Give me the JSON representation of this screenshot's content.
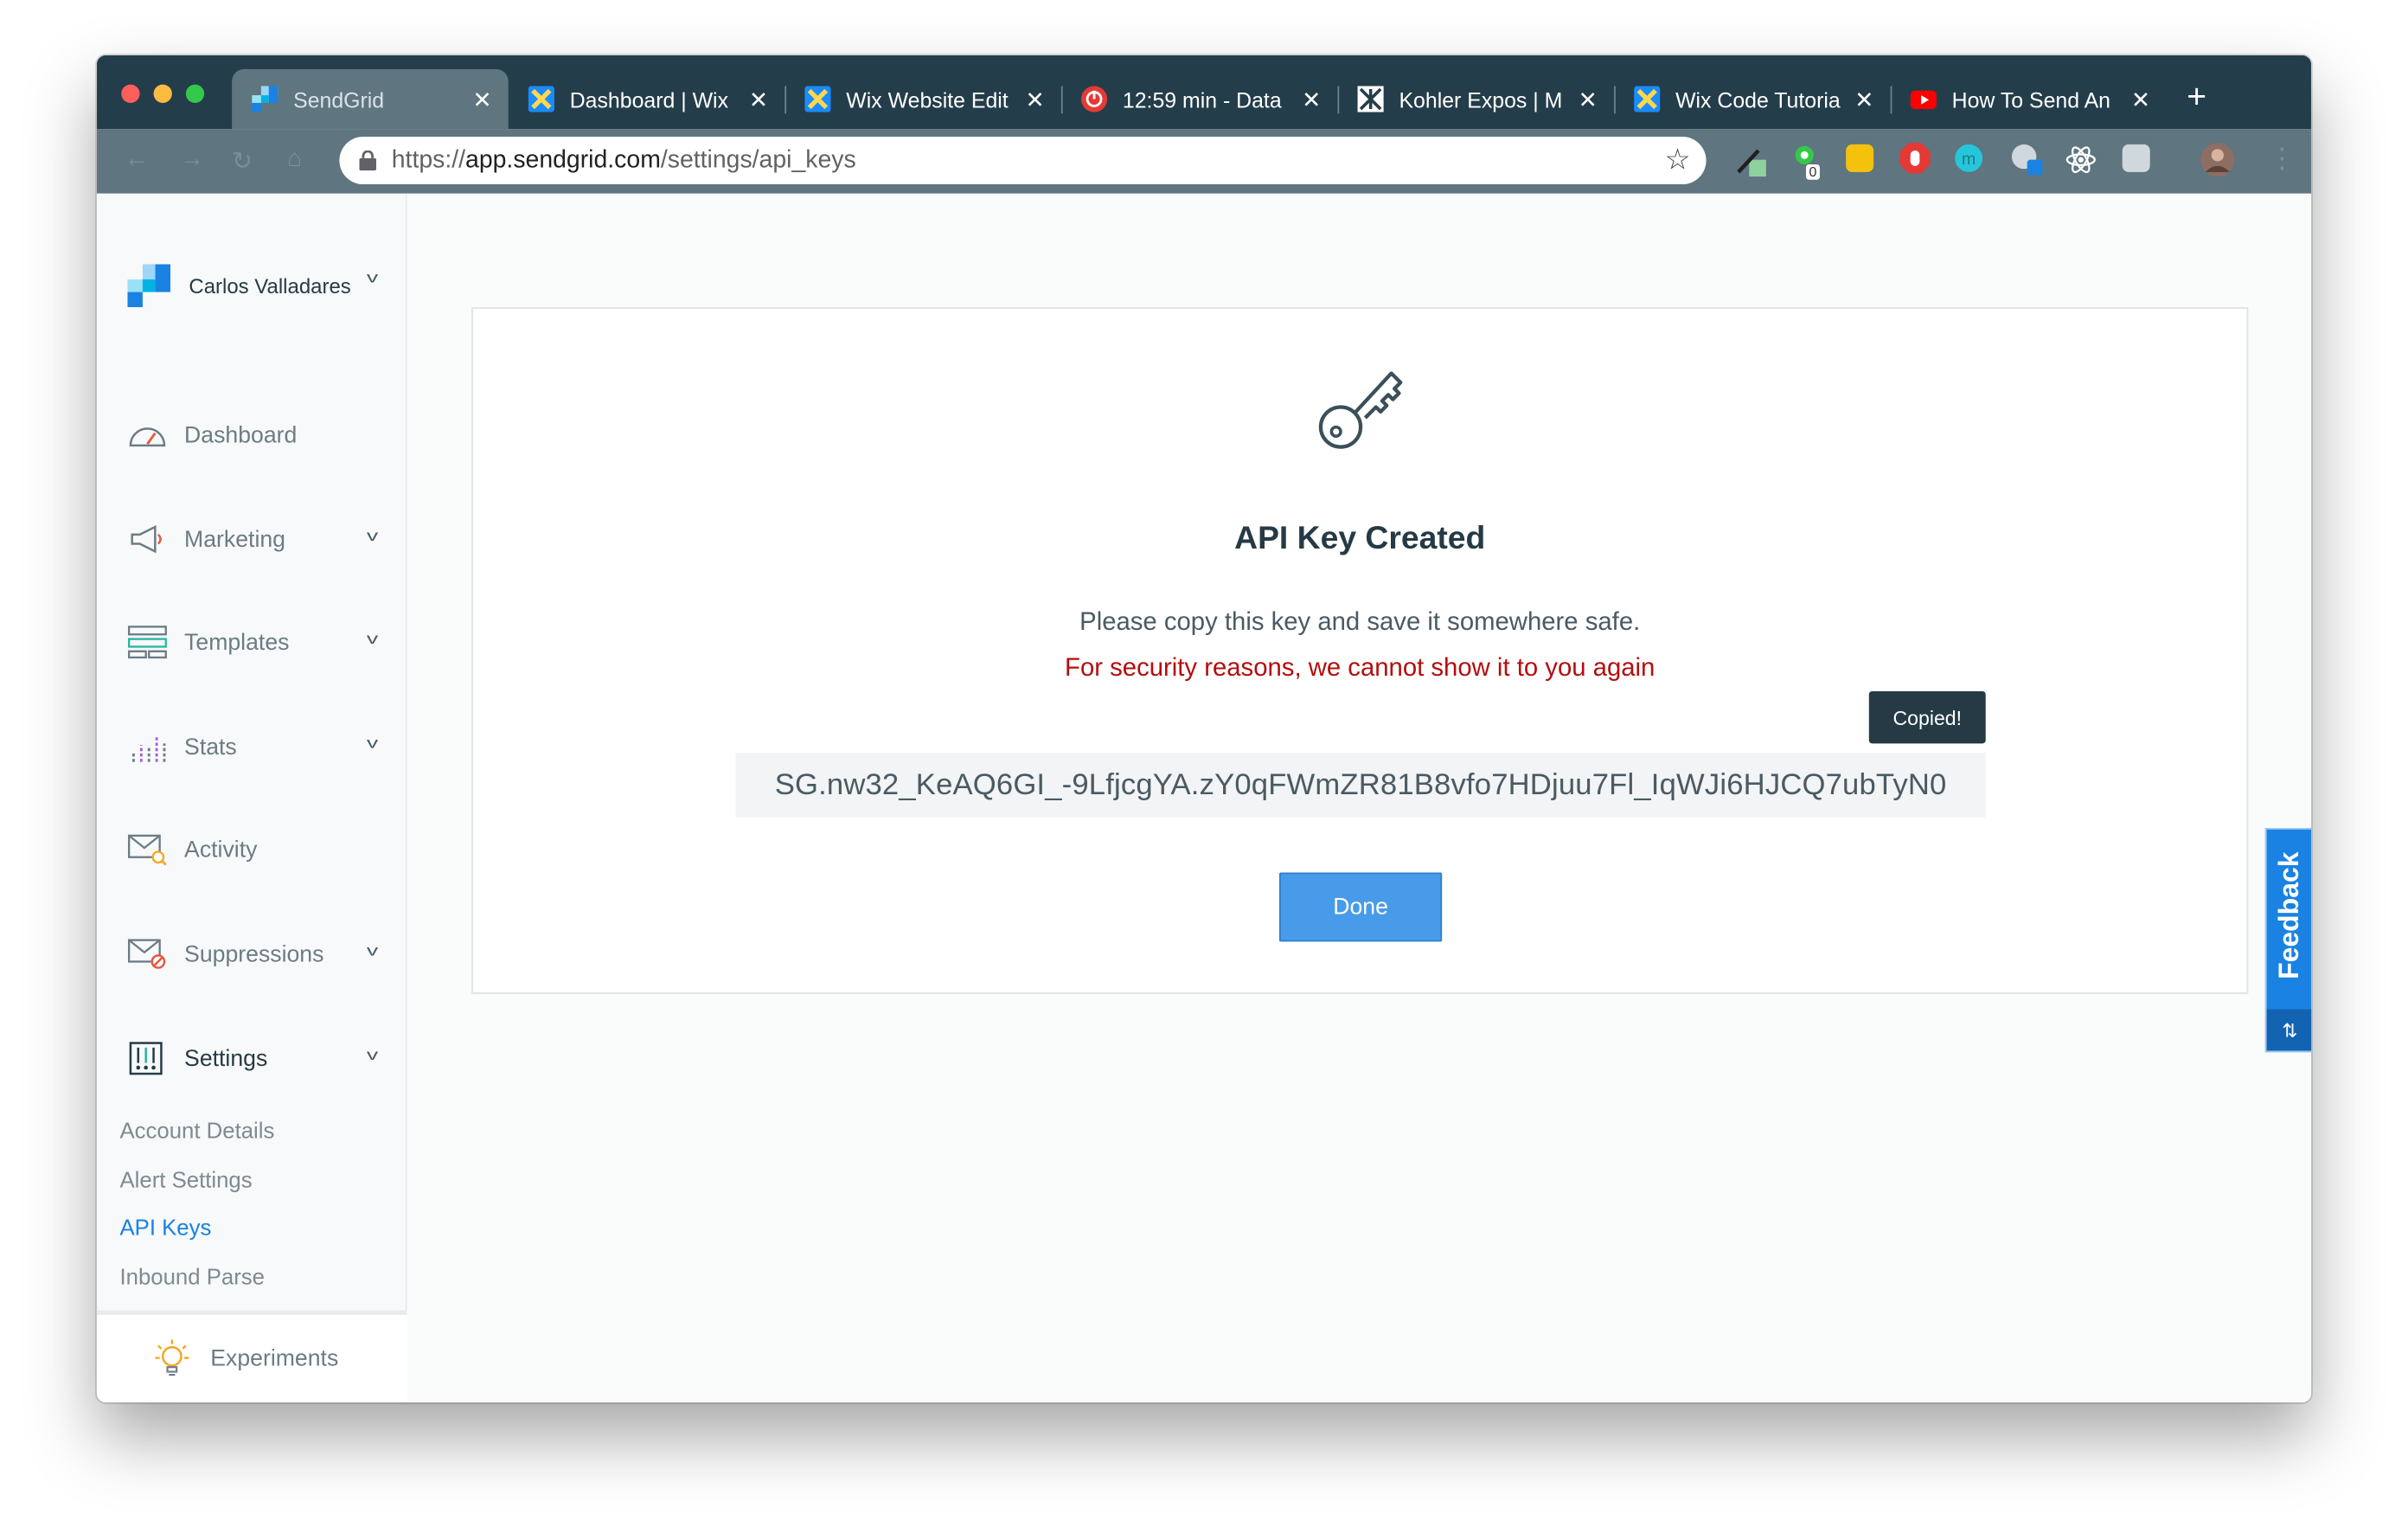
{
  "browser": {
    "tabs": [
      {
        "title": "SendGrid",
        "active": true
      },
      {
        "title": "Dashboard | Wix",
        "active": false
      },
      {
        "title": "Wix Website Edit",
        "active": false
      },
      {
        "title": "12:59 min - Data",
        "active": false
      },
      {
        "title": "Kohler Expos | M",
        "active": false
      },
      {
        "title": "Wix Code Tutoria",
        "active": false
      },
      {
        "title": "How To Send An",
        "active": false
      }
    ],
    "new_tab": "+",
    "close_glyph": "✕",
    "url_scheme": "https://",
    "url_host": "app.sendgrid.com",
    "url_path": "/settings/api_keys",
    "star_glyph": "☆",
    "extension_badge": "0"
  },
  "sidebar": {
    "account_name": "Carlos Valladares",
    "nav": [
      {
        "label": "Dashboard",
        "icon": "dashboard-icon",
        "has_chevron": false
      },
      {
        "label": "Marketing",
        "icon": "megaphone-icon",
        "has_chevron": true
      },
      {
        "label": "Templates",
        "icon": "templates-icon",
        "has_chevron": true
      },
      {
        "label": "Stats",
        "icon": "stats-icon",
        "has_chevron": true
      },
      {
        "label": "Activity",
        "icon": "activity-icon",
        "has_chevron": false
      },
      {
        "label": "Suppressions",
        "icon": "suppressions-icon",
        "has_chevron": true
      },
      {
        "label": "Settings",
        "icon": "settings-icon",
        "has_chevron": true
      }
    ],
    "settings_sub": [
      "Account Details",
      "Alert Settings",
      "API Keys",
      "Inbound Parse"
    ],
    "active_sub": "API Keys",
    "experiments_label": "Experiments"
  },
  "card": {
    "title": "API Key Created",
    "message": "Please copy this key and save it somewhere safe.",
    "warning": "For security reasons, we cannot show it to you again",
    "tooltip": "Copied!",
    "api_key": "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",
    "done_label": "Done"
  },
  "feedback_label": "Feedback",
  "colors": {
    "tab_strip": "#243d4a",
    "toolbar": "#5f7580",
    "accent_blue": "#1a82e2",
    "button_blue": "#489be8",
    "warning_red": "#b50d0d",
    "heading": "#263a45"
  }
}
